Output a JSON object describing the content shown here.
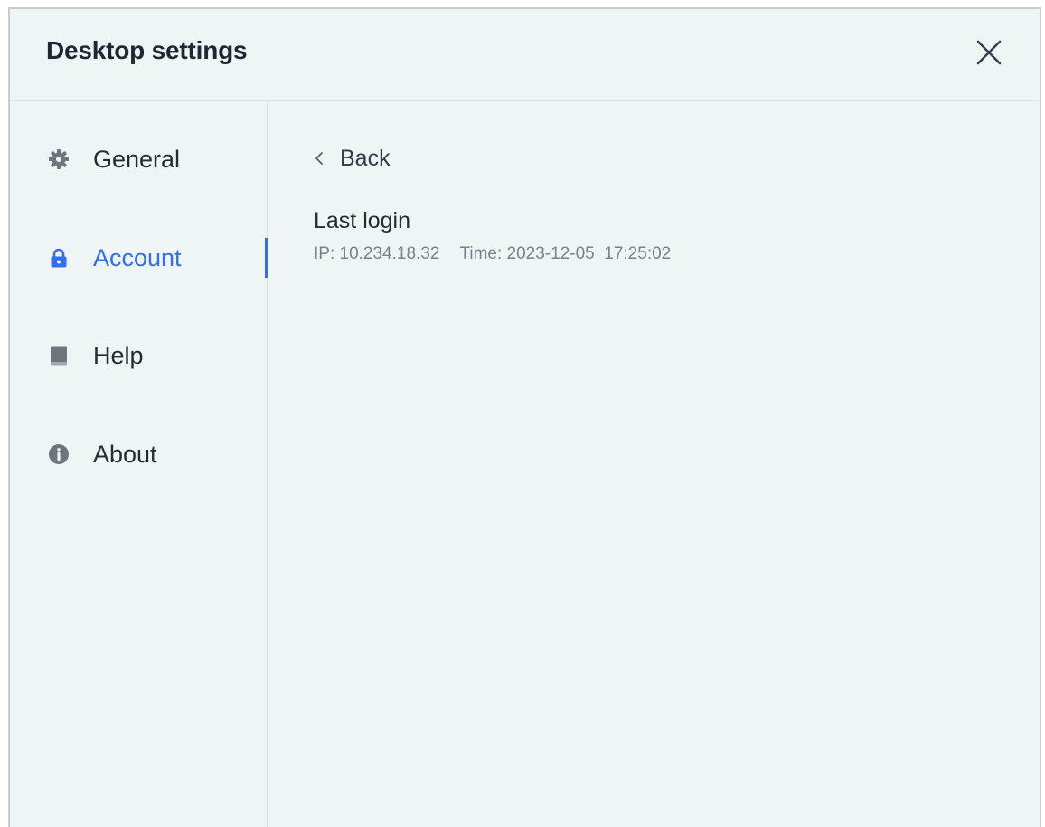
{
  "window": {
    "title": "Desktop settings",
    "close_icon": "close-icon"
  },
  "sidebar": {
    "items": [
      {
        "label": "General",
        "icon": "gear-icon",
        "active": false
      },
      {
        "label": "Account",
        "icon": "lock-icon",
        "active": true
      },
      {
        "label": "Help",
        "icon": "book-icon",
        "active": false
      },
      {
        "label": "About",
        "icon": "info-icon",
        "active": false
      }
    ]
  },
  "content": {
    "back_label": "Back",
    "section_title": "Last login",
    "ip_text": "IP: 10.234.18.32",
    "time_text": "Time: 2023-12-05  17:25:02"
  },
  "colors": {
    "background": "#eff4f5",
    "accent": "#2f6ff0",
    "text": "#262b33",
    "muted": "#7b808a"
  }
}
